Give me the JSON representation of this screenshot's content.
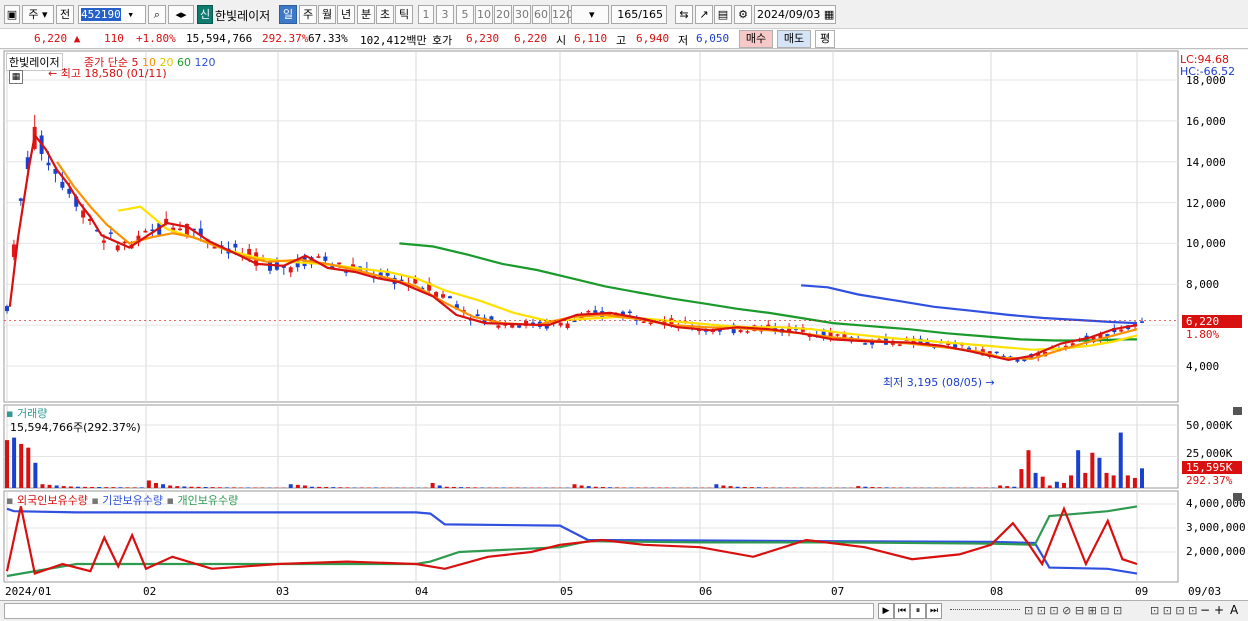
{
  "toolbar": {
    "period_label": "주",
    "prev_label": "전",
    "code": "452190",
    "new_badge": "신",
    "stock_name": "한빛레이저",
    "periods": [
      "일",
      "주",
      "월",
      "년",
      "분",
      "초",
      "틱"
    ],
    "selected_period": "일",
    "intervals": [
      "1",
      "3",
      "5",
      "10",
      "20",
      "30",
      "60",
      "120"
    ],
    "count": "165",
    "count_total": "/165",
    "date": "2024/09/03"
  },
  "quote": {
    "price": "6,220",
    "change_arrow": "▲",
    "change": "110",
    "change_pct": "+1.80%",
    "volume": "15,594,766",
    "vol_ratio": "292.37%",
    "turnover": "67.33%",
    "amount": "102,412백만",
    "hoga_label": "호가",
    "ask": "6,230",
    "bid": "6,220",
    "open_label": "시",
    "open": "6,110",
    "high_label": "고",
    "high": "6,940",
    "low_label": "저",
    "low": "6,050",
    "buy_label": "매수",
    "sell_label": "매도",
    "avg_label": "평"
  },
  "price_panel": {
    "stock_label": "한빛레이저",
    "legend_prefix": "종가 단순",
    "ma_periods": [
      "5",
      "10",
      "20",
      "60",
      "120"
    ],
    "ma_colors": [
      "#d81010",
      "#ff9000",
      "#ffe000",
      "#1a9a2a",
      "#3050e0"
    ],
    "max_label": "최고 18,580 (01/11)",
    "min_label": "최저 3,195 (08/05)",
    "lc": "LC:94.68",
    "hc": "HC:-66.52",
    "current_tag": "6,220",
    "current_pct": "1.80%",
    "yticks": [
      "18,000",
      "16,000",
      "14,000",
      "12,000",
      "10,000",
      "8,000",
      "6,000",
      "4,000"
    ]
  },
  "volume_panel": {
    "title": "거래량",
    "info": "15,594,766주(292.37%)",
    "yticks": [
      "50,000K",
      "25,000K"
    ],
    "current_tag": "15,595K",
    "current_pct": "292.37%"
  },
  "holding_panel": {
    "series": [
      "외국인보유수량",
      "기관보유수량",
      "개인보유수량"
    ],
    "colors": [
      "#d81010",
      "#3050e0",
      "#2e9a50"
    ],
    "yticks": [
      "4,000,000",
      "3,000,000",
      "2,000,000"
    ]
  },
  "xaxis": {
    "labels": [
      "2024/01",
      "02",
      "03",
      "04",
      "05",
      "06",
      "07",
      "08",
      "09"
    ],
    "end_label": "09/03"
  },
  "chart_data": {
    "type": "candlestick",
    "ma_5": [
      [
        0.05,
        6900
      ],
      [
        0.2,
        10300
      ],
      [
        0.4,
        13800
      ],
      [
        0.5,
        15300
      ],
      [
        0.7,
        14600
      ],
      [
        0.9,
        13600
      ],
      [
        1.1,
        12900
      ],
      [
        1.3,
        12000
      ],
      [
        1.5,
        11300
      ],
      [
        1.7,
        10400
      ],
      [
        2.2,
        9800
      ],
      [
        2.6,
        10500
      ],
      [
        2.9,
        11000
      ],
      [
        3.3,
        10800
      ],
      [
        3.7,
        10100
      ],
      [
        4.2,
        9500
      ],
      [
        4.6,
        9000
      ],
      [
        5.1,
        8900
      ],
      [
        5.5,
        9400
      ],
      [
        5.9,
        8800
      ],
      [
        6.4,
        8600
      ],
      [
        6.8,
        8300
      ],
      [
        7.2,
        8100
      ],
      [
        7.8,
        7400
      ],
      [
        8.2,
        6500
      ],
      [
        8.7,
        6100
      ],
      [
        9.2,
        6050
      ],
      [
        9.8,
        6000
      ],
      [
        10.3,
        6500
      ],
      [
        10.9,
        6600
      ],
      [
        11.5,
        6300
      ],
      [
        12.1,
        5900
      ],
      [
        12.7,
        5750
      ],
      [
        13.2,
        5900
      ],
      [
        13.8,
        5800
      ],
      [
        14.4,
        5600
      ],
      [
        15.0,
        5300
      ],
      [
        15.6,
        5200
      ],
      [
        16.2,
        5150
      ],
      [
        16.7,
        5000
      ],
      [
        17.2,
        4700
      ],
      [
        17.8,
        4300
      ],
      [
        18.2,
        4500
      ],
      [
        18.7,
        5100
      ],
      [
        19.2,
        5400
      ],
      [
        19.6,
        5800
      ],
      [
        20.0,
        6000
      ]
    ],
    "ma_10": [
      [
        0.9,
        14000
      ],
      [
        1.2,
        12800
      ],
      [
        1.5,
        11800
      ],
      [
        1.8,
        10900
      ],
      [
        2.2,
        10000
      ],
      [
        2.6,
        10300
      ],
      [
        3.0,
        10500
      ],
      [
        3.4,
        10300
      ],
      [
        3.8,
        9900
      ],
      [
        4.3,
        9400
      ],
      [
        4.8,
        9100
      ],
      [
        5.4,
        9200
      ],
      [
        5.9,
        9000
      ],
      [
        6.4,
        8700
      ],
      [
        7.0,
        8300
      ],
      [
        7.5,
        7900
      ],
      [
        8.0,
        7100
      ],
      [
        8.5,
        6400
      ],
      [
        9.0,
        6100
      ],
      [
        9.6,
        6000
      ],
      [
        10.2,
        6400
      ],
      [
        10.8,
        6500
      ],
      [
        11.4,
        6300
      ],
      [
        12.0,
        6000
      ],
      [
        12.6,
        5900
      ],
      [
        13.2,
        5850
      ],
      [
        13.8,
        5750
      ],
      [
        14.4,
        5600
      ],
      [
        15.0,
        5400
      ],
      [
        15.6,
        5250
      ],
      [
        16.2,
        5100
      ],
      [
        16.8,
        4900
      ],
      [
        17.3,
        4700
      ],
      [
        17.7,
        4400
      ],
      [
        18.2,
        4350
      ],
      [
        18.7,
        4800
      ],
      [
        19.2,
        5200
      ],
      [
        19.6,
        5500
      ],
      [
        20.0,
        5800
      ]
    ],
    "ma_20": [
      [
        2.0,
        11600
      ],
      [
        2.4,
        11800
      ],
      [
        2.9,
        10700
      ],
      [
        3.5,
        10200
      ],
      [
        4.0,
        9700
      ],
      [
        4.6,
        9300
      ],
      [
        5.2,
        9100
      ],
      [
        5.8,
        9000
      ],
      [
        6.4,
        8800
      ],
      [
        7.0,
        8600
      ],
      [
        7.5,
        8300
      ],
      [
        8.0,
        7700
      ],
      [
        8.6,
        7200
      ],
      [
        9.2,
        6600
      ],
      [
        9.8,
        6200
      ],
      [
        10.4,
        6300
      ],
      [
        11.0,
        6400
      ],
      [
        11.6,
        6300
      ],
      [
        12.2,
        6150
      ],
      [
        12.8,
        6000
      ],
      [
        13.4,
        5900
      ],
      [
        14.0,
        5900
      ],
      [
        14.6,
        5800
      ],
      [
        15.2,
        5600
      ],
      [
        15.8,
        5400
      ],
      [
        16.4,
        5250
      ],
      [
        17.0,
        5100
      ],
      [
        17.6,
        4950
      ],
      [
        18.2,
        4800
      ],
      [
        18.7,
        4850
      ],
      [
        19.2,
        5000
      ],
      [
        19.6,
        5200
      ],
      [
        20.0,
        5500
      ]
    ],
    "ma_60": [
      [
        7.2,
        10000
      ],
      [
        7.8,
        9850
      ],
      [
        8.4,
        9450
      ],
      [
        9.0,
        9000
      ],
      [
        9.6,
        8700
      ],
      [
        10.2,
        8300
      ],
      [
        10.8,
        7900
      ],
      [
        11.4,
        7600
      ],
      [
        12.0,
        7300
      ],
      [
        12.6,
        7050
      ],
      [
        13.2,
        6800
      ],
      [
        13.8,
        6600
      ],
      [
        14.4,
        6350
      ],
      [
        15.0,
        6100
      ],
      [
        15.6,
        5950
      ],
      [
        16.2,
        5800
      ],
      [
        16.8,
        5600
      ],
      [
        17.4,
        5450
      ],
      [
        18.0,
        5300
      ],
      [
        18.6,
        5250
      ],
      [
        19.2,
        5250
      ],
      [
        19.8,
        5300
      ],
      [
        20.0,
        5300
      ]
    ],
    "ma_120": [
      [
        14.4,
        7950
      ],
      [
        14.9,
        7850
      ],
      [
        15.4,
        7500
      ],
      [
        16.0,
        7200
      ],
      [
        16.6,
        6900
      ],
      [
        17.2,
        6700
      ],
      [
        17.8,
        6500
      ],
      [
        18.4,
        6350
      ],
      [
        19.0,
        6250
      ],
      [
        19.6,
        6150
      ],
      [
        20.0,
        6100
      ]
    ],
    "volume_k": [
      38000,
      40000,
      35000,
      32000,
      20000,
      3000,
      2500,
      2000,
      1500,
      1200,
      1000,
      900,
      800,
      800,
      700,
      700,
      600,
      500,
      500,
      500,
      6000,
      4000,
      3000,
      2000,
      1500,
      1200,
      1000,
      900,
      800,
      700,
      600,
      500,
      500,
      400,
      400,
      400,
      400,
      300,
      300,
      300,
      3000,
      2500,
      2000,
      1000,
      900,
      800,
      700,
      600,
      500,
      400,
      400,
      400,
      400,
      400,
      300,
      300,
      300,
      300,
      300,
      300,
      4000,
      2000,
      1000,
      800,
      700,
      600,
      500,
      400,
      400,
      400,
      400,
      400,
      400,
      300,
      300,
      300,
      300,
      300,
      300,
      300,
      3000,
      2000,
      1500,
      1000,
      800,
      600,
      500,
      400,
      400,
      400,
      400,
      400,
      400,
      400,
      300,
      300,
      300,
      300,
      300,
      300,
      3000,
      2000,
      1500,
      1000,
      800,
      700,
      600,
      500,
      400,
      400,
      400,
      400,
      400,
      300,
      300,
      300,
      300,
      300,
      300,
      300,
      1500,
      1000,
      800,
      600,
      500,
      400,
      400,
      400,
      300,
      300,
      300,
      300,
      300,
      300,
      300,
      300,
      300,
      300,
      300,
      300,
      2000,
      1500,
      1000,
      15000,
      30000,
      12000,
      9000,
      2000,
      5000,
      4000,
      10000,
      30000,
      12000,
      28000,
      24000,
      12000,
      10000,
      44000,
      10000,
      8000,
      15595
    ]
  }
}
